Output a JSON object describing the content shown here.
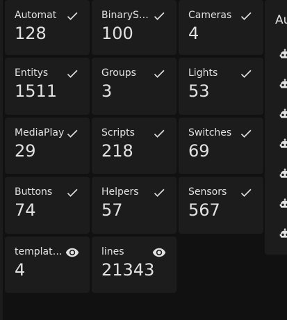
{
  "tiles": [
    {
      "label": "Automat",
      "value": "128",
      "icon": "check-icon"
    },
    {
      "label": "BinarySe…",
      "value": "100",
      "icon": "check-icon"
    },
    {
      "label": "Cameras",
      "value": "4",
      "icon": "check-icon"
    },
    {
      "label": "Entitys",
      "value": "1511",
      "icon": "check-icon"
    },
    {
      "label": "Groups",
      "value": "3",
      "icon": "check-icon"
    },
    {
      "label": "Lights",
      "value": "53",
      "icon": "check-icon"
    },
    {
      "label": "MediaPlay",
      "value": "29",
      "icon": "check-icon"
    },
    {
      "label": "Scripts",
      "value": "218",
      "icon": "check-icon"
    },
    {
      "label": "Switches",
      "value": "69",
      "icon": "check-icon"
    },
    {
      "label": "Buttons",
      "value": "74",
      "icon": "check-icon"
    },
    {
      "label": "Helpers",
      "value": "57",
      "icon": "check-icon"
    },
    {
      "label": "Sensors",
      "value": "567",
      "icon": "check-icon"
    },
    {
      "label": "template…",
      "value": "4",
      "icon": "eye-icon"
    },
    {
      "label": "lines",
      "value": "21343",
      "icon": "eye-icon"
    }
  ],
  "side_card": {
    "title": "Au",
    "icon": "robot-icon",
    "icon_count": 7
  },
  "colors": {
    "background": "#111111",
    "card": "#1c1c1c",
    "text": "#e1e1e1"
  }
}
